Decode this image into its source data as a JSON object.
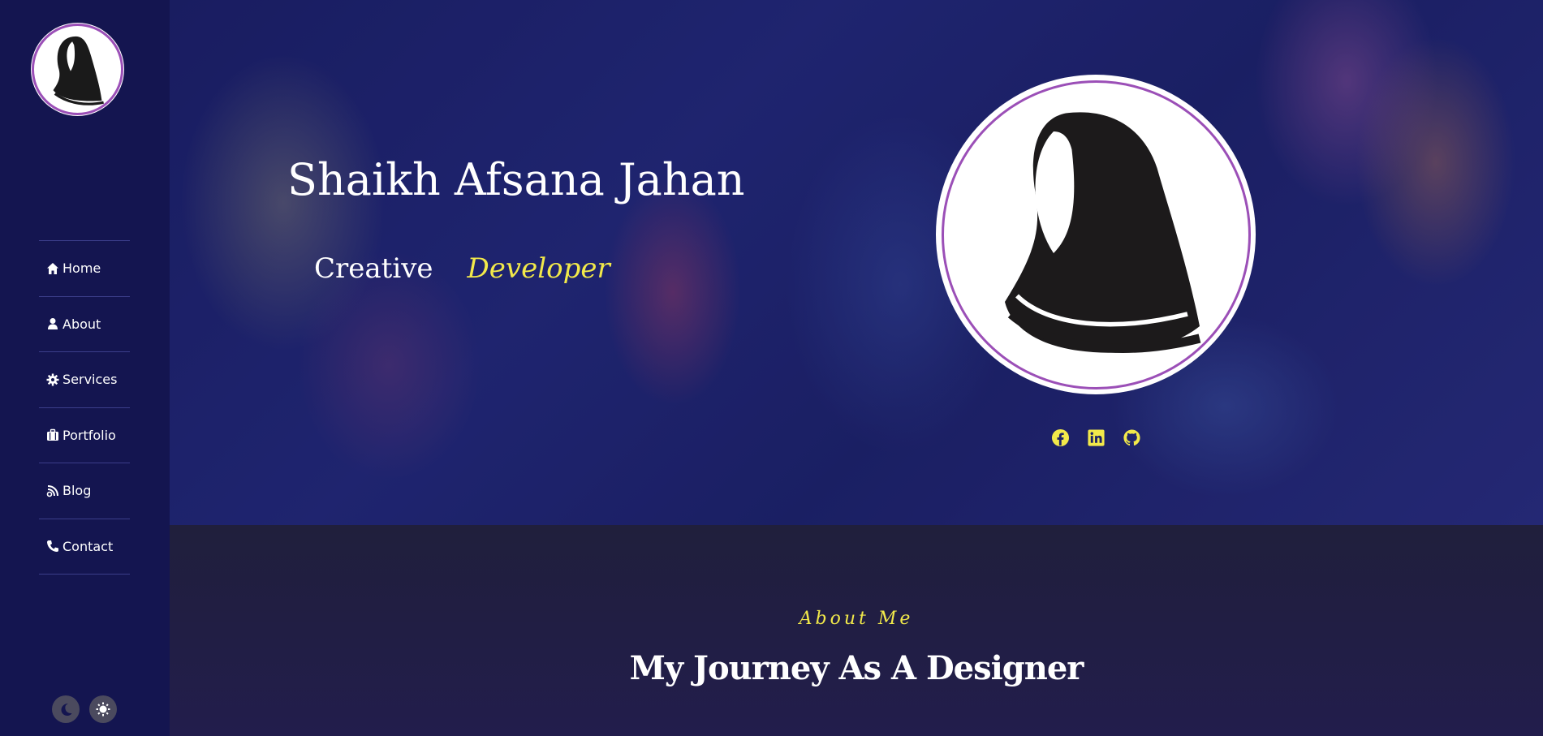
{
  "colors": {
    "sidebar_bg": "#141550",
    "accent_yellow": "#f2e94a",
    "ring_purple": "#9b4fb7",
    "section_bg": "#201f3c"
  },
  "sidebar": {
    "logo_icon": "hijab-woman-icon",
    "nav": [
      {
        "label": "Home",
        "icon": "home-icon"
      },
      {
        "label": "About",
        "icon": "user-icon"
      },
      {
        "label": "Services",
        "icon": "gear-icon"
      },
      {
        "label": "Portfolio",
        "icon": "briefcase-icon"
      },
      {
        "label": "Blog",
        "icon": "blog-icon"
      },
      {
        "label": "Contact",
        "icon": "phone-icon"
      }
    ],
    "theme_toggles": [
      {
        "icon": "moon-icon"
      },
      {
        "icon": "sun-icon"
      }
    ]
  },
  "hero": {
    "name": "Shaikh Afsana Jahan",
    "role_prefix": "Creative",
    "role_accent": "Developer",
    "avatar_icon": "hijab-woman-icon",
    "socials": [
      {
        "icon": "facebook-icon"
      },
      {
        "icon": "linkedin-icon"
      },
      {
        "icon": "github-icon"
      }
    ]
  },
  "about": {
    "kicker": "About Me",
    "title": "My Journey As A Designer"
  }
}
